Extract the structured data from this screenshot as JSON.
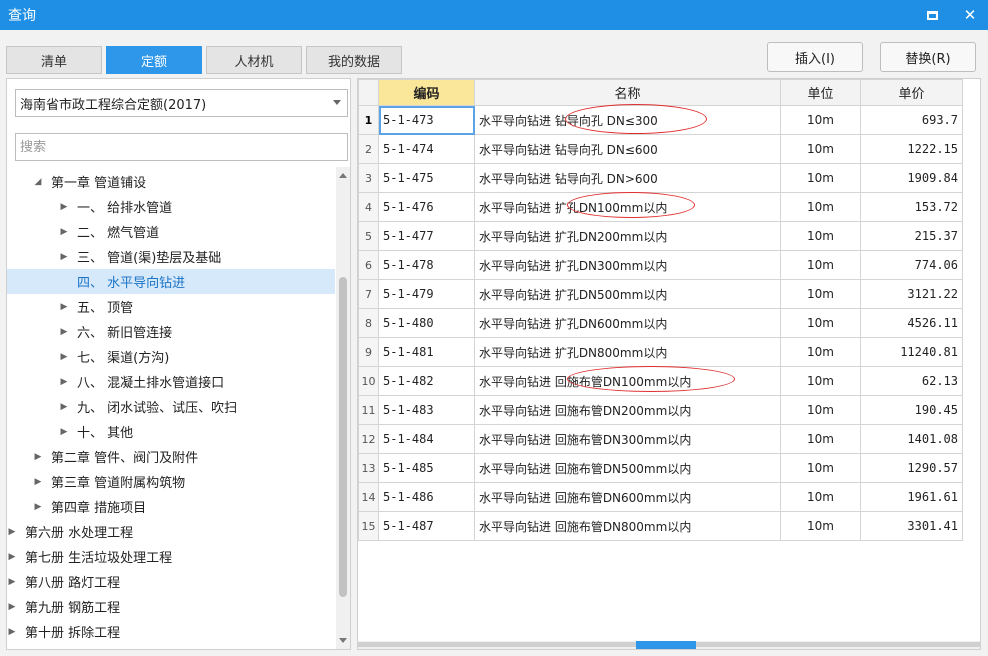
{
  "window": {
    "title": "查询"
  },
  "tabs": [
    {
      "label": "清单",
      "active": false
    },
    {
      "label": "定额",
      "active": true
    },
    {
      "label": "人材机",
      "active": false
    },
    {
      "label": "我的数据",
      "active": false
    }
  ],
  "actions": {
    "insert_label": "插入(I)",
    "replace_label": "替换(R)"
  },
  "left": {
    "library_select": "海南省市政工程综合定额(2017)",
    "search_placeholder": "搜索",
    "tree": [
      {
        "label": "第一章 管道铺设",
        "expanded": true
      },
      {
        "label": "一、 给排水管道"
      },
      {
        "label": "二、 燃气管道"
      },
      {
        "label": "三、 管道(渠)垫层及基础"
      },
      {
        "label": "四、 水平导向钻进",
        "selected": true
      },
      {
        "label": "五、 顶管"
      },
      {
        "label": "六、 新旧管连接"
      },
      {
        "label": "七、 渠道(方沟)"
      },
      {
        "label": "八、 混凝土排水管道接口"
      },
      {
        "label": "九、 闭水试验、试压、吹扫"
      },
      {
        "label": "十、 其他"
      },
      {
        "label": "第二章 管件、阀门及附件"
      },
      {
        "label": "第三章 管道附属构筑物"
      },
      {
        "label": "第四章 措施项目"
      },
      {
        "label": "第六册 水处理工程"
      },
      {
        "label": "第七册 生活垃圾处理工程"
      },
      {
        "label": "第八册 路灯工程"
      },
      {
        "label": "第九册 钢筋工程"
      },
      {
        "label": "第十册 拆除工程"
      }
    ]
  },
  "table": {
    "headers": {
      "code": "编码",
      "name": "名称",
      "unit": "单位",
      "price": "单价"
    },
    "rows": [
      {
        "n": "1",
        "code": "5-1-473",
        "name": "水平导向钻进 钻导向孔 DN≤300",
        "unit": "10m",
        "price": "693.7"
      },
      {
        "n": "2",
        "code": "5-1-474",
        "name": "水平导向钻进 钻导向孔 DN≤600",
        "unit": "10m",
        "price": "1222.15"
      },
      {
        "n": "3",
        "code": "5-1-475",
        "name": "水平导向钻进 钻导向孔 DN>600",
        "unit": "10m",
        "price": "1909.84"
      },
      {
        "n": "4",
        "code": "5-1-476",
        "name": "水平导向钻进 扩孔DN100mm以内",
        "unit": "10m",
        "price": "153.72"
      },
      {
        "n": "5",
        "code": "5-1-477",
        "name": "水平导向钻进 扩孔DN200mm以内",
        "unit": "10m",
        "price": "215.37"
      },
      {
        "n": "6",
        "code": "5-1-478",
        "name": "水平导向钻进 扩孔DN300mm以内",
        "unit": "10m",
        "price": "774.06"
      },
      {
        "n": "7",
        "code": "5-1-479",
        "name": "水平导向钻进 扩孔DN500mm以内",
        "unit": "10m",
        "price": "3121.22"
      },
      {
        "n": "8",
        "code": "5-1-480",
        "name": "水平导向钻进 扩孔DN600mm以内",
        "unit": "10m",
        "price": "4526.11"
      },
      {
        "n": "9",
        "code": "5-1-481",
        "name": "水平导向钻进 扩孔DN800mm以内",
        "unit": "10m",
        "price": "11240.81"
      },
      {
        "n": "10",
        "code": "5-1-482",
        "name": "水平导向钻进 回施布管DN100mm以内",
        "unit": "10m",
        "price": "62.13"
      },
      {
        "n": "11",
        "code": "5-1-483",
        "name": "水平导向钻进 回施布管DN200mm以内",
        "unit": "10m",
        "price": "190.45"
      },
      {
        "n": "12",
        "code": "5-1-484",
        "name": "水平导向钻进 回施布管DN300mm以内",
        "unit": "10m",
        "price": "1401.08"
      },
      {
        "n": "13",
        "code": "5-1-485",
        "name": "水平导向钻进 回施布管DN500mm以内",
        "unit": "10m",
        "price": "1290.57"
      },
      {
        "n": "14",
        "code": "5-1-486",
        "name": "水平导向钻进 回施布管DN600mm以内",
        "unit": "10m",
        "price": "1961.61"
      },
      {
        "n": "15",
        "code": "5-1-487",
        "name": "水平导向钻进 回施布管DN800mm以内",
        "unit": "10m",
        "price": "3301.41"
      }
    ]
  },
  "colors": {
    "accent": "#2e97ea",
    "titlebar": "#1e8fe4",
    "annotation": "#e03030",
    "code_header": "#fbe79a"
  }
}
